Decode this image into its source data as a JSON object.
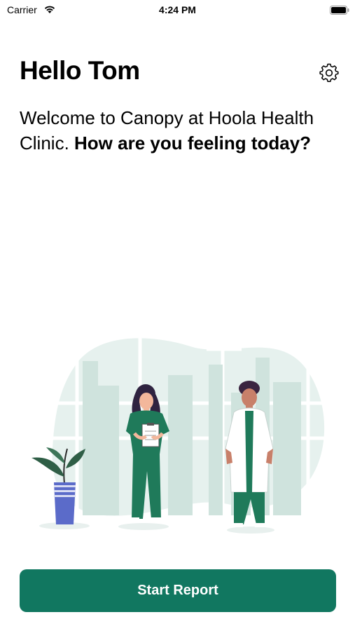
{
  "status_bar": {
    "carrier": "Carrier",
    "time": "4:24 PM"
  },
  "header": {
    "greeting": "Hello Tom",
    "settings_icon": "gear-icon"
  },
  "welcome": {
    "intro": "Welcome to Canopy at Hoola Health Clinic. ",
    "question": "How are you feeling today?"
  },
  "illustration": {
    "description_icon": "clinic-illustration"
  },
  "actions": {
    "start_report_label": "Start Report"
  },
  "colors": {
    "accent": "#117760",
    "illustration_bg": "#e3efec",
    "scrub_green": "#1f7a5a",
    "pot_blue": "#5b6bc9"
  }
}
